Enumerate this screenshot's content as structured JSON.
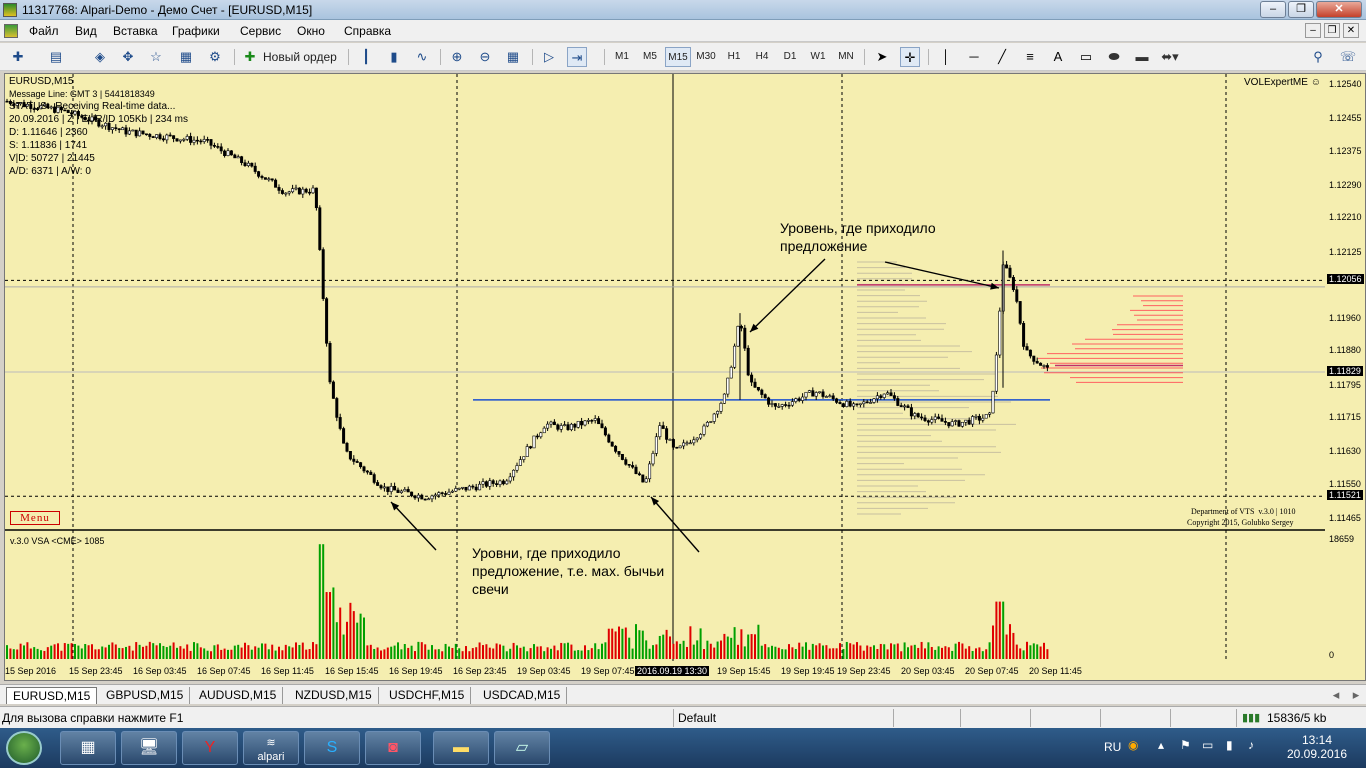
{
  "window": {
    "title": "11317768: Alpari-Demo - Демо Счет - [EURUSD,M15]"
  },
  "menu": [
    "Файл",
    "Вид",
    "Вставка",
    "Графики",
    "Сервис",
    "Окно",
    "Справка"
  ],
  "toolbar": {
    "new_order": "Новый ордер",
    "timeframes": [
      "M1",
      "M5",
      "M15",
      "M30",
      "H1",
      "H4",
      "D1",
      "W1",
      "MN"
    ],
    "selected_timeframe": "M15",
    "text_tool": "A"
  },
  "chart": {
    "symbol": "EURUSD,M15",
    "message_line": "Message Line: GMT 3 | 5441818349",
    "status": "STATUS:  Receiving Real-time data...",
    "info_lines": [
      "20.09.2016 | Z | EUR/ID 105Kb | 234 ms",
      "D: 1.11646 | 2360",
      "S: 1.11836 | 1741",
      "V|D: 50727 | 21445",
      "A/D: 6371 | A/W: 0"
    ],
    "expert": "VOLExpertME",
    "menu_button": "Menu",
    "copyright": [
      "Department of VTS  v.3.0 | 1010",
      "Copyright 2015, Golubko Sergey"
    ],
    "sub_label": "v.3.0 VSA <CME> 1085",
    "sub_max": "18659",
    "sub_zero": "0",
    "annotations": {
      "top": [
        "Уровень, где приходило",
        "предложение"
      ],
      "bottom": [
        "Уровни, где приходило",
        "предложение, т.е. мах. бычьи",
        "свечи"
      ]
    },
    "price_labels": [
      "1.12540",
      "1.12455",
      "1.12375",
      "1.12290",
      "1.12210",
      "1.12125",
      "1.11960",
      "1.11880",
      "1.11795",
      "1.11715",
      "1.11630",
      "1.11550",
      "1.11465"
    ],
    "price_boxes": [
      "1.12056",
      "1.11829",
      "1.11521"
    ],
    "time_labels": [
      "15 Sep 2016",
      "15 Sep 23:45",
      "16 Sep 03:45",
      "16 Sep 07:45",
      "16 Sep 11:45",
      "16 Sep 15:45",
      "16 Sep 19:45",
      "16 Sep 23:45",
      "19 Sep 03:45",
      "19 Sep 07:45",
      "19 Sep 15:45",
      "19 Sep 19:45",
      "19 Sep 23:45",
      "20 Sep 03:45",
      "20 Sep 07:45",
      "20 Sep 11:45"
    ],
    "crosshair_time": "2016.09.19 13:30",
    "colors": {
      "background": "#f5eeb0",
      "candle": "#000000",
      "support_line": "#1a4fd0",
      "volume_up": "#00a000",
      "volume_down": "#e00000",
      "profile": "#ff6060"
    }
  },
  "tabs": [
    "EURUSD,M15",
    "GBPUSD,M15",
    "AUDUSD,M15",
    "NZDUSD,M15",
    "USDCHF,M15",
    "USDCAD,M15"
  ],
  "active_tab": "EURUSD,M15",
  "status": {
    "help": "Для вызова справки нажмите F1",
    "profile": "Default",
    "traffic": "15836/5 kb"
  },
  "tray": {
    "lang": "RU",
    "time": "13:14",
    "date": "20.09.2016"
  },
  "taskbar": {
    "apps": [
      "calculator",
      "computer",
      "yandex",
      "alpari",
      "skype",
      "office",
      "explorer",
      "notes"
    ],
    "alpari_label": "alpari"
  }
}
